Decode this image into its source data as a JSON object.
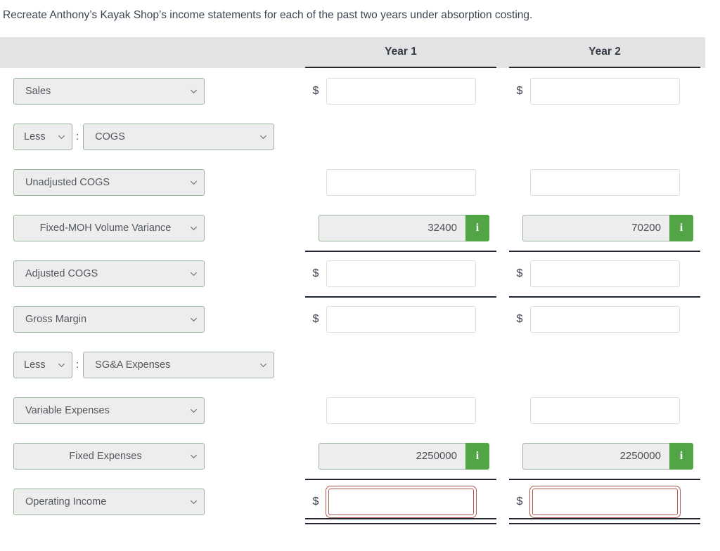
{
  "prompt": "Recreate Anthony’s Kayak Shop’s income statements for each of the past two years under absorption costing.",
  "colors": {
    "header_band": "#e3e3e3",
    "info_button_green": "#52a447",
    "dropdown_border_green": "#9bb49b",
    "total_border_red": "#b05a50",
    "rule_dark": "#222831",
    "text": "#3c4450"
  },
  "header": {
    "label_column": "",
    "year1": "Year 1",
    "year2": "Year 2"
  },
  "rows": [
    {
      "id": "sales",
      "label": "Sales",
      "type": "input-dollar",
      "year1": "",
      "year2": "",
      "placeholder": ""
    },
    {
      "id": "less-cogs",
      "label": "COGS",
      "operator": "Less",
      "separator": ":",
      "type": "section-header",
      "year1": "",
      "year2": ""
    },
    {
      "id": "unadjusted-cogs",
      "label": "Unadjusted COGS",
      "type": "input",
      "year1": "",
      "year2": ""
    },
    {
      "id": "fixed-moh-volume-variance",
      "label": "Fixed-MOH Volume Variance",
      "type": "readonly-info",
      "year1": "32400",
      "year2": "70200",
      "info_icon": "info-icon"
    },
    {
      "id": "adjusted-cogs",
      "label": "Adjusted COGS",
      "type": "input-dollar",
      "rule_top": true,
      "year1": "",
      "year2": ""
    },
    {
      "id": "gross-margin",
      "label": "Gross Margin",
      "type": "input-dollar",
      "rule_top": true,
      "year1": "",
      "year2": ""
    },
    {
      "id": "less-sga-expenses",
      "label": "SG&A Expenses",
      "operator": "Less",
      "separator": ":",
      "type": "section-header",
      "year1": "",
      "year2": ""
    },
    {
      "id": "variable-expenses",
      "label": "Variable Expenses",
      "type": "input",
      "year1": "",
      "year2": ""
    },
    {
      "id": "fixed-expenses",
      "label": "Fixed Expenses",
      "type": "readonly-info",
      "year1": "2250000",
      "year2": "2250000",
      "info_icon": "info-icon"
    },
    {
      "id": "operating-income",
      "label": "Operating Income",
      "type": "input-total",
      "rule_top": true,
      "rule_bottom_double": true,
      "year1": "",
      "year2": ""
    }
  ],
  "symbols": {
    "currency": "$",
    "info": "i",
    "chevron": "chevron-down-icon"
  }
}
